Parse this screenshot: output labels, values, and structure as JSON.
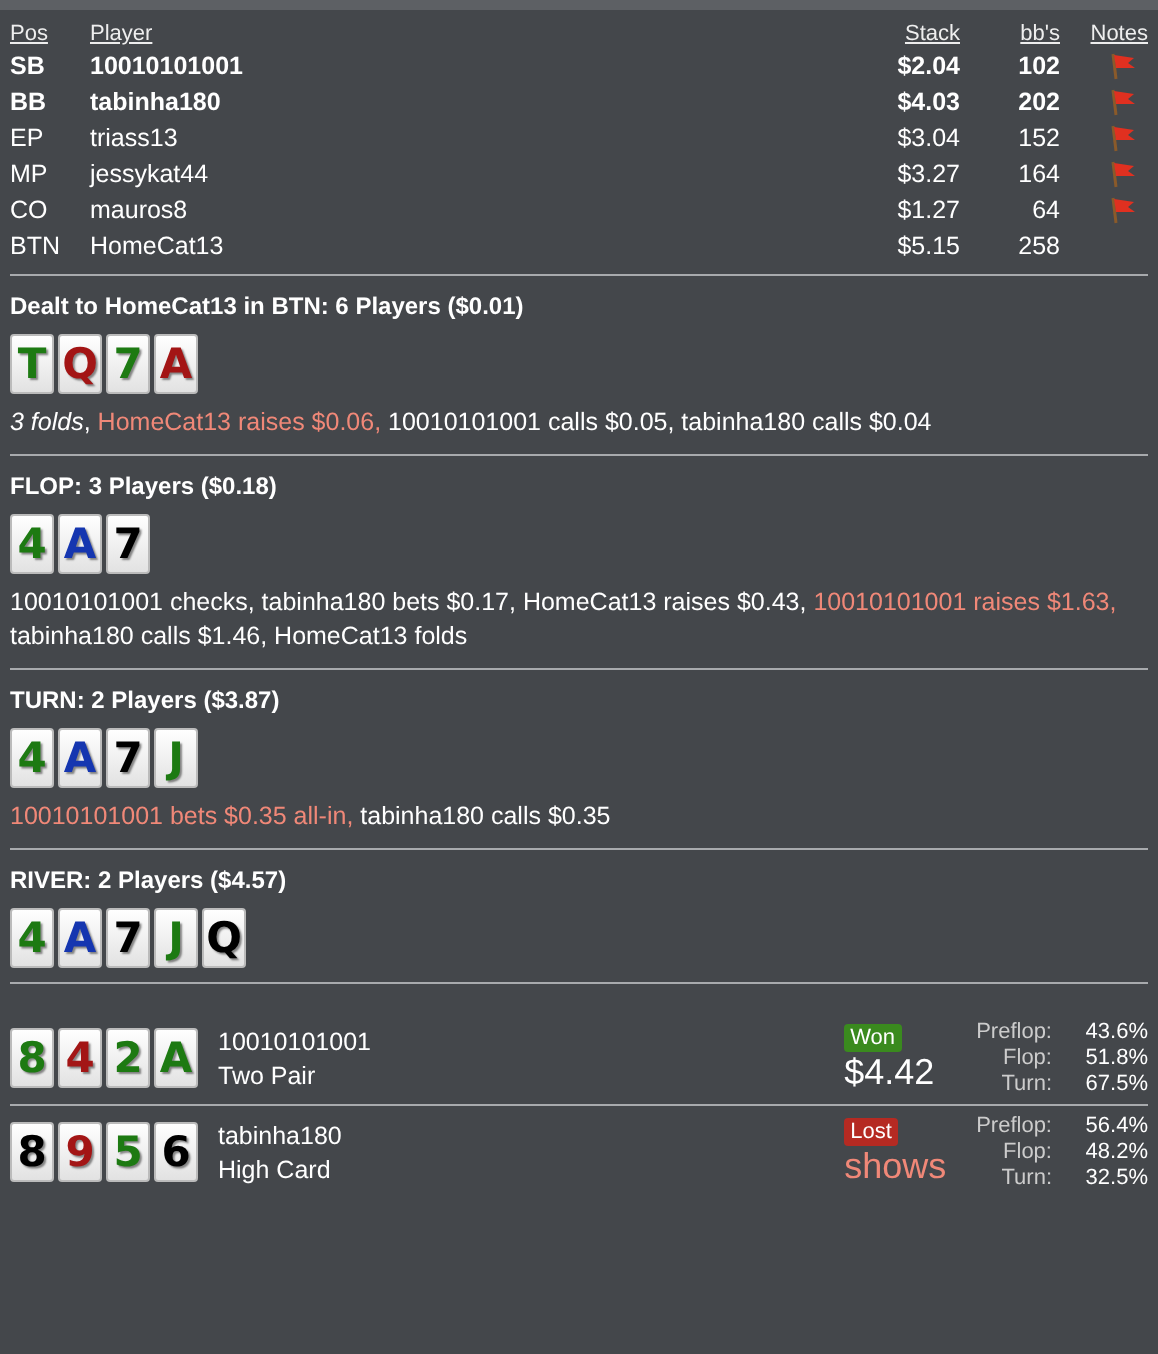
{
  "players": {
    "columns": [
      "Pos",
      "Player",
      "Stack",
      "bb's",
      "Notes"
    ],
    "rows": [
      {
        "pos": "SB",
        "name": "10010101001",
        "stack": "$2.04",
        "bbs": "102",
        "blind": true,
        "note": true
      },
      {
        "pos": "BB",
        "name": "tabinha180",
        "stack": "$4.03",
        "bbs": "202",
        "blind": true,
        "note": true
      },
      {
        "pos": "EP",
        "name": "triass13",
        "stack": "$3.04",
        "bbs": "152",
        "blind": false,
        "note": true
      },
      {
        "pos": "MP",
        "name": "jessykat44",
        "stack": "$3.27",
        "bbs": "164",
        "blind": false,
        "note": true
      },
      {
        "pos": "CO",
        "name": "mauros8",
        "stack": "$1.27",
        "bbs": "64",
        "blind": false,
        "note": true
      },
      {
        "pos": "BTN",
        "name": "HomeCat13",
        "stack": "$5.15",
        "bbs": "258",
        "blind": false,
        "note": false
      }
    ]
  },
  "streets": [
    {
      "title": "Dealt to HomeCat13 in BTN: 6 Players ($0.01)",
      "cards": [
        {
          "rank": "T",
          "color": "#1d7a12"
        },
        {
          "rank": "Q",
          "color": "#a31515"
        },
        {
          "rank": "7",
          "color": "#1d7a12"
        },
        {
          "rank": "A",
          "color": "#a31515"
        }
      ],
      "actions": [
        {
          "kind": "italic",
          "text": "3 folds"
        },
        {
          "kind": "plain",
          "text": ", "
        },
        {
          "kind": "hero",
          "text": "HomeCat13 raises $0.06, "
        },
        {
          "kind": "plain",
          "text": "10010101001 calls $0.05, tabinha180 calls $0.04"
        }
      ]
    },
    {
      "title": "FLOP: 3 Players ($0.18)",
      "cards": [
        {
          "rank": "4",
          "color": "#1d7a12"
        },
        {
          "rank": "A",
          "color": "#1536b0"
        },
        {
          "rank": "7",
          "color": "#000000"
        }
      ],
      "actions": [
        {
          "kind": "plain",
          "text": "10010101001 checks, tabinha180 bets $0.17, HomeCat13 raises $0.43, "
        },
        {
          "kind": "hero",
          "text": "10010101001 raises $1.63, "
        },
        {
          "kind": "plain",
          "text": "tabinha180 calls $1.46, HomeCat13 folds"
        }
      ]
    },
    {
      "title": "TURN: 2 Players ($3.87)",
      "cards": [
        {
          "rank": "4",
          "color": "#1d7a12"
        },
        {
          "rank": "A",
          "color": "#1536b0"
        },
        {
          "rank": "7",
          "color": "#000000"
        },
        {
          "rank": "J",
          "color": "#1d7a12"
        }
      ],
      "actions": [
        {
          "kind": "hero",
          "text": "10010101001 bets $0.35 all-in, "
        },
        {
          "kind": "plain",
          "text": "tabinha180 calls $0.35"
        }
      ]
    },
    {
      "title": "RIVER: 2 Players ($4.57)",
      "cards": [
        {
          "rank": "4",
          "color": "#1d7a12"
        },
        {
          "rank": "A",
          "color": "#1536b0"
        },
        {
          "rank": "7",
          "color": "#000000"
        },
        {
          "rank": "J",
          "color": "#1d7a12"
        },
        {
          "rank": "Q",
          "color": "#000000"
        }
      ]
    }
  ],
  "results": [
    {
      "cards": [
        {
          "rank": "8",
          "color": "#1d7a12"
        },
        {
          "rank": "4",
          "color": "#a31515"
        },
        {
          "rank": "2",
          "color": "#1d7a12"
        },
        {
          "rank": "A",
          "color": "#1d7a12"
        }
      ],
      "name": "10010101001",
      "hand": "Two Pair",
      "won": true,
      "badge": "Won",
      "amount": "$4.42",
      "equity": [
        {
          "label": "Preflop:",
          "value": "43.6%"
        },
        {
          "label": "Flop:",
          "value": "51.8%"
        },
        {
          "label": "Turn:",
          "value": "67.5%"
        }
      ]
    },
    {
      "cards": [
        {
          "rank": "8",
          "color": "#000000"
        },
        {
          "rank": "9",
          "color": "#a31515"
        },
        {
          "rank": "5",
          "color": "#1d7a12"
        },
        {
          "rank": "6",
          "color": "#000000"
        }
      ],
      "name": "tabinha180",
      "hand": "High Card",
      "won": false,
      "badge": "Lost",
      "amount": "shows",
      "equity": [
        {
          "label": "Preflop:",
          "value": "56.4%"
        },
        {
          "label": "Flop:",
          "value": "48.2%"
        },
        {
          "label": "Turn:",
          "value": "32.5%"
        }
      ]
    }
  ]
}
